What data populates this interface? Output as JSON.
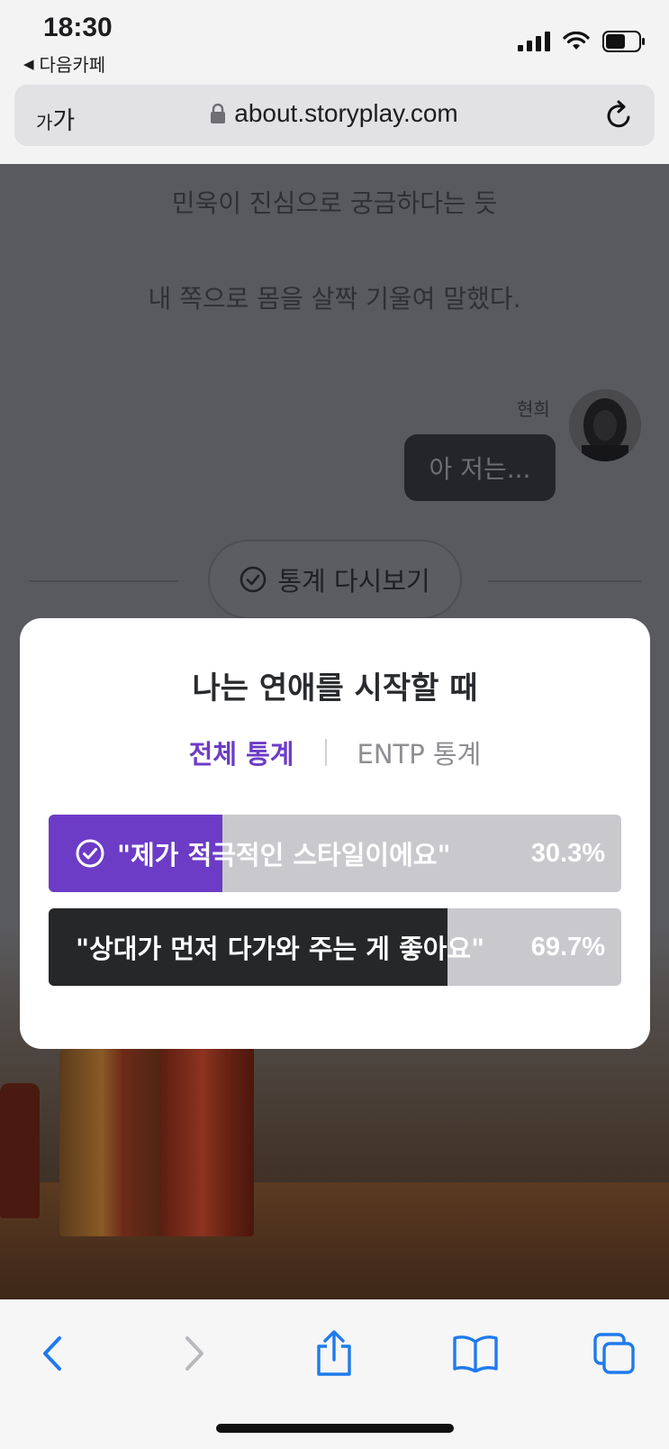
{
  "status_bar": {
    "time": "18:30",
    "back_app": "다음카페",
    "back_arrow": "◀"
  },
  "browser": {
    "text_size_small": "가",
    "text_size_large": "가",
    "url": "about.storyplay.com"
  },
  "story": {
    "narration_1": "민욱이 진심으로 궁금하다는 듯",
    "narration_2": "내 쪽으로 몸을 살짝 기울여 말했다.",
    "speaker_name": "현희",
    "speech": "아 저는...",
    "stats_button_label": "통계 다시보기"
  },
  "poll_modal": {
    "title": "나는 연애를 시작할 때",
    "tab_all": "전체 통계",
    "tab_entp": "ENTP 통계",
    "options": [
      {
        "label": "\"제가 적극적인 스타일이에요\"",
        "percent_text": "30.3%",
        "fraction": 0.303,
        "fill_color": "#6c3cc6",
        "selected": true
      },
      {
        "label": "\"상대가 먼저 다가와 주는 게 좋아요\"",
        "percent_text": "69.7%",
        "fraction": 0.697,
        "fill_color": "#262729",
        "selected": false
      }
    ]
  },
  "toolbar": {
    "icons": [
      "back-icon",
      "forward-icon",
      "share-icon",
      "bookmarks-icon",
      "tabs-icon"
    ],
    "accent": "#1f7aec"
  }
}
